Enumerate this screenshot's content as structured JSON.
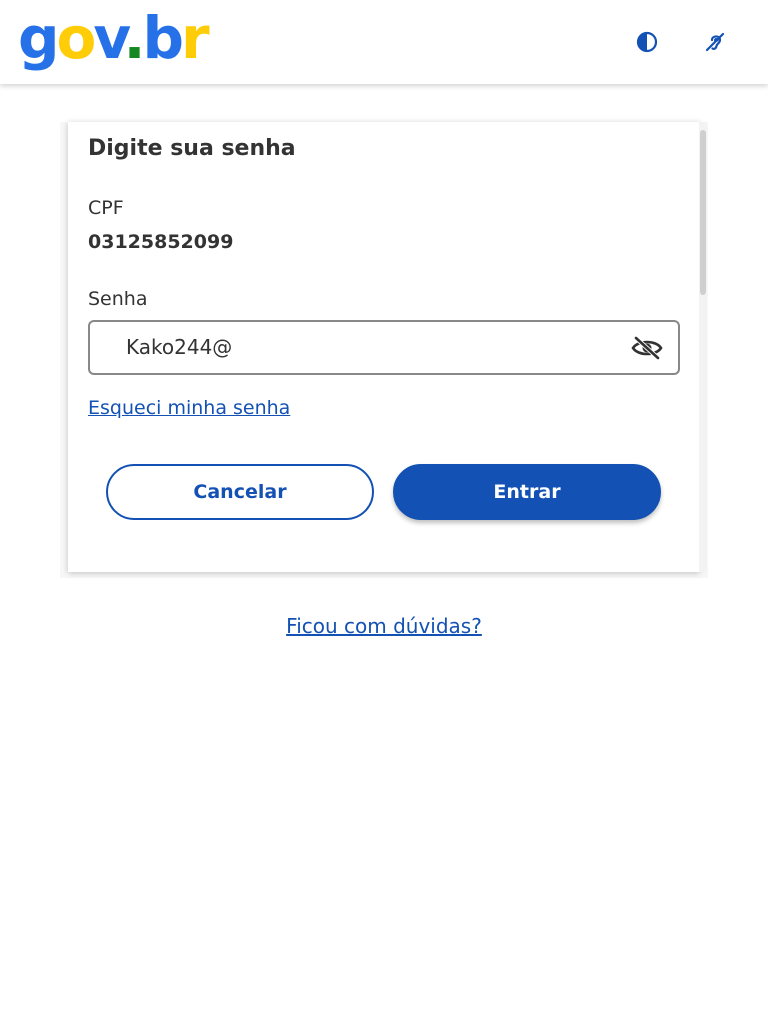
{
  "header": {
    "logo": {
      "g": "g",
      "o": "o",
      "v": "v",
      "dot": ".",
      "b": "b",
      "r": "r"
    },
    "contrast_icon": "contrast-icon",
    "accessibility_icon": "hearing-accessibility-icon"
  },
  "login": {
    "title": "Digite sua senha",
    "cpf_label": "CPF",
    "cpf_value": "03125852099",
    "password_label": "Senha",
    "password_value": "Kako244@",
    "visibility_icon": "eye-slash-icon",
    "forgot_link": "Esqueci minha senha",
    "cancel_label": "Cancelar",
    "enter_label": "Entrar"
  },
  "footer": {
    "help_link": "Ficou com dúvidas?"
  },
  "colors": {
    "primary": "#1351b4",
    "logo_blue": "#2670e8",
    "logo_yellow": "#ffcd07",
    "logo_green": "#168821",
    "text": "#333333"
  }
}
